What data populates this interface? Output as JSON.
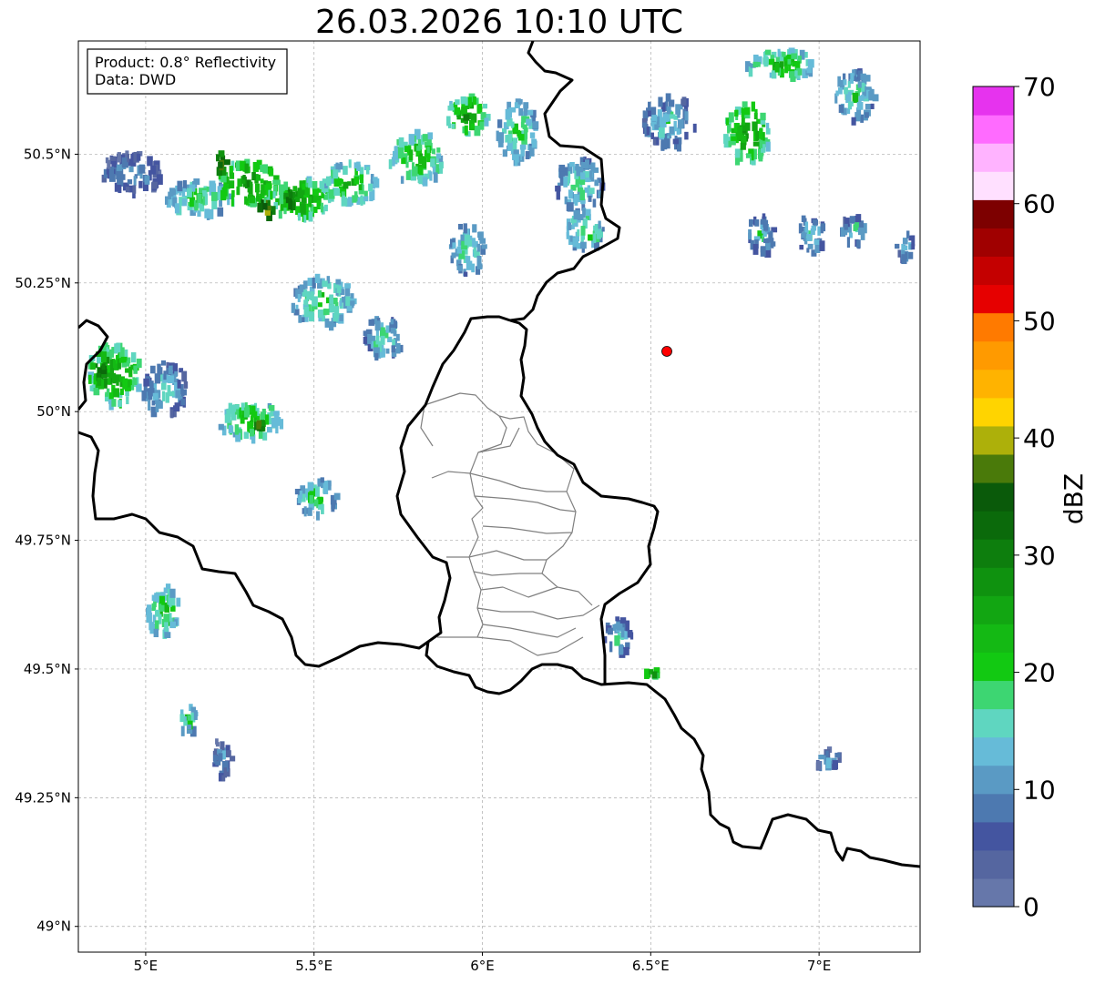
{
  "title": "26.03.2026 10:10 UTC",
  "info_box": {
    "product": "Product: 0.8° Reflectivity",
    "data": "Data: DWD"
  },
  "x_ticks": [
    "5°E",
    "5.5°E",
    "6°E",
    "6.5°E",
    "7°E"
  ],
  "y_ticks": [
    "50.5°N",
    "50.25°N",
    "50°N",
    "49.75°N",
    "49.5°N",
    "49.25°N",
    "49°N"
  ],
  "colorbar": {
    "label": "dBZ",
    "ticks": [
      "0",
      "10",
      "20",
      "30",
      "40",
      "50",
      "60",
      "70"
    ],
    "colors": [
      "#6677aa",
      "#5566a0",
      "#4455a0",
      "#4d79b0",
      "#5a9ac4",
      "#66bbd8",
      "#5fd6c0",
      "#3dd672",
      "#12c912",
      "#14b914",
      "#12a612",
      "#0f920f",
      "#0d7e0d",
      "#0b6a0b",
      "#0a5a0a",
      "#4a7a0a",
      "#adb00a",
      "#ffd400",
      "#ffb300",
      "#ff9a00",
      "#ff7a00",
      "#e60000",
      "#c40000",
      "#a00000",
      "#7d0000",
      "#ffe0ff",
      "#ffb3ff",
      "#ff6bff",
      "#e633ee"
    ]
  },
  "radar_site_color": "#ff0000",
  "chart_data": {
    "type": "map",
    "title": "26.03.2026 10:10 UTC",
    "xlabel": "",
    "ylabel": "",
    "xlim": [
      4.8,
      7.3
    ],
    "ylim": [
      48.95,
      50.72
    ],
    "x_ticks": [
      5.0,
      5.5,
      6.0,
      6.5,
      7.0
    ],
    "y_ticks": [
      49.0,
      49.25,
      49.5,
      49.75,
      50.0,
      50.25,
      50.5
    ],
    "grid": true,
    "colorbar": {
      "label": "dBZ",
      "min": 0,
      "max": 70,
      "ticks": [
        0,
        10,
        20,
        30,
        40,
        50,
        60,
        70
      ]
    },
    "radar_site": {
      "lon": 6.55,
      "lat": 50.11
    },
    "echo_cells": [
      {
        "lon": 4.95,
        "lat": 50.47,
        "dbz": 15,
        "w": 0.18,
        "h": 0.08
      },
      {
        "lon": 5.15,
        "lat": 50.42,
        "dbz": 22,
        "w": 0.2,
        "h": 0.07
      },
      {
        "lon": 5.3,
        "lat": 50.45,
        "dbz": 30,
        "w": 0.18,
        "h": 0.09
      },
      {
        "lon": 5.45,
        "lat": 50.42,
        "dbz": 28,
        "w": 0.2,
        "h": 0.08
      },
      {
        "lon": 5.6,
        "lat": 50.45,
        "dbz": 25,
        "w": 0.16,
        "h": 0.08
      },
      {
        "lon": 5.8,
        "lat": 50.5,
        "dbz": 25,
        "w": 0.16,
        "h": 0.1
      },
      {
        "lon": 5.95,
        "lat": 50.58,
        "dbz": 28,
        "w": 0.12,
        "h": 0.08
      },
      {
        "lon": 5.22,
        "lat": 50.49,
        "dbz": 40,
        "w": 0.03,
        "h": 0.04
      },
      {
        "lon": 5.35,
        "lat": 50.4,
        "dbz": 42,
        "w": 0.04,
        "h": 0.04
      },
      {
        "lon": 5.42,
        "lat": 50.42,
        "dbz": 40,
        "w": 0.03,
        "h": 0.03
      },
      {
        "lon": 4.9,
        "lat": 50.08,
        "dbz": 28,
        "w": 0.16,
        "h": 0.12
      },
      {
        "lon": 4.86,
        "lat": 50.09,
        "dbz": 35,
        "w": 0.05,
        "h": 0.06
      },
      {
        "lon": 5.05,
        "lat": 50.05,
        "dbz": 18,
        "w": 0.14,
        "h": 0.1
      },
      {
        "lon": 5.3,
        "lat": 49.99,
        "dbz": 25,
        "w": 0.2,
        "h": 0.07
      },
      {
        "lon": 5.33,
        "lat": 49.98,
        "dbz": 38,
        "w": 0.03,
        "h": 0.03
      },
      {
        "lon": 5.5,
        "lat": 49.84,
        "dbz": 22,
        "w": 0.12,
        "h": 0.07
      },
      {
        "lon": 5.52,
        "lat": 50.22,
        "dbz": 22,
        "w": 0.18,
        "h": 0.1
      },
      {
        "lon": 5.7,
        "lat": 50.15,
        "dbz": 20,
        "w": 0.12,
        "h": 0.08
      },
      {
        "lon": 5.95,
        "lat": 50.32,
        "dbz": 20,
        "w": 0.1,
        "h": 0.1
      },
      {
        "lon": 6.1,
        "lat": 50.55,
        "dbz": 22,
        "w": 0.12,
        "h": 0.12
      },
      {
        "lon": 6.28,
        "lat": 50.45,
        "dbz": 20,
        "w": 0.14,
        "h": 0.1
      },
      {
        "lon": 6.3,
        "lat": 50.36,
        "dbz": 22,
        "w": 0.12,
        "h": 0.08
      },
      {
        "lon": 6.55,
        "lat": 50.57,
        "dbz": 18,
        "w": 0.16,
        "h": 0.1
      },
      {
        "lon": 6.78,
        "lat": 50.55,
        "dbz": 28,
        "w": 0.14,
        "h": 0.12
      },
      {
        "lon": 6.88,
        "lat": 50.68,
        "dbz": 25,
        "w": 0.2,
        "h": 0.06
      },
      {
        "lon": 7.1,
        "lat": 50.62,
        "dbz": 20,
        "w": 0.12,
        "h": 0.1
      },
      {
        "lon": 6.82,
        "lat": 50.35,
        "dbz": 18,
        "w": 0.08,
        "h": 0.08
      },
      {
        "lon": 6.97,
        "lat": 50.35,
        "dbz": 18,
        "w": 0.08,
        "h": 0.08
      },
      {
        "lon": 7.1,
        "lat": 50.36,
        "dbz": 18,
        "w": 0.08,
        "h": 0.06
      },
      {
        "lon": 7.25,
        "lat": 50.33,
        "dbz": 16,
        "w": 0.06,
        "h": 0.06
      },
      {
        "lon": 5.05,
        "lat": 49.62,
        "dbz": 24,
        "w": 0.1,
        "h": 0.1
      },
      {
        "lon": 5.12,
        "lat": 49.41,
        "dbz": 22,
        "w": 0.06,
        "h": 0.05
      },
      {
        "lon": 5.22,
        "lat": 49.33,
        "dbz": 14,
        "w": 0.06,
        "h": 0.08
      },
      {
        "lon": 6.4,
        "lat": 49.57,
        "dbz": 18,
        "w": 0.08,
        "h": 0.08
      },
      {
        "lon": 6.5,
        "lat": 49.5,
        "dbz": 30,
        "w": 0.04,
        "h": 0.02
      },
      {
        "lon": 7.02,
        "lat": 49.33,
        "dbz": 14,
        "w": 0.08,
        "h": 0.04
      }
    ]
  }
}
